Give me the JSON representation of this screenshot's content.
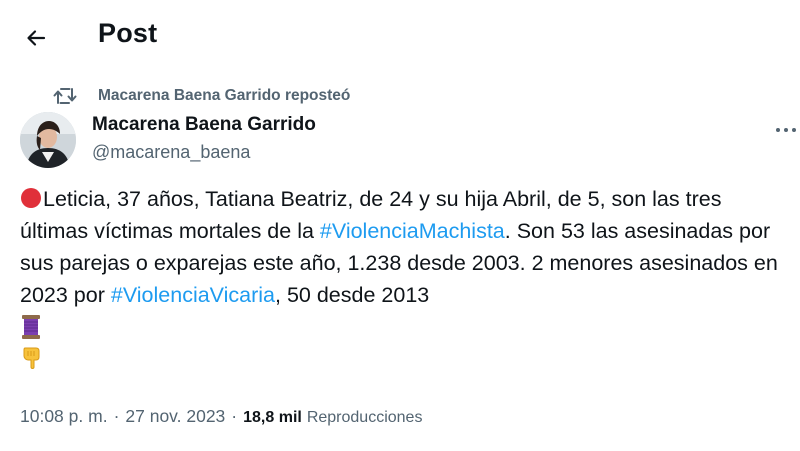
{
  "header": {
    "back_icon": "arrow-left-icon",
    "title": "Post"
  },
  "repost": {
    "icon": "repost-icon",
    "text": "Macarena Baena Garrido reposteó"
  },
  "author": {
    "name": "Macarena Baena Garrido",
    "handle": "@macarena_baena",
    "avatar_icon": "avatar-photo"
  },
  "post": {
    "lead_icon": "red-circle-emoji",
    "text_1": "Leticia, 37 años, Tatiana Beatriz, de 24 y su hija Abril, de 5, son las tres últimas víctimas mortales de la ",
    "hashtag_1": "#ViolenciaMachista",
    "text_2": ". Son 53 las asesinadas por sus parejas o exparejas este año, 1.238 desde 2003. 2 menores asesinados en 2023 por ",
    "hashtag_2": "#ViolenciaVicaria",
    "text_3": ", 50 desde 2013",
    "trailing_icons": [
      "spool-of-thread-emoji",
      "pointing-down-emoji"
    ]
  },
  "meta": {
    "time": "10:08 p. m.",
    "separator": "·",
    "date": "27 nov. 2023",
    "views_count": "18,8 mil",
    "views_label": "Reproducciones"
  },
  "colors": {
    "text": "#0f1419",
    "secondary": "#536471",
    "link": "#1d9bf0",
    "red_circle": "#e0303a"
  }
}
